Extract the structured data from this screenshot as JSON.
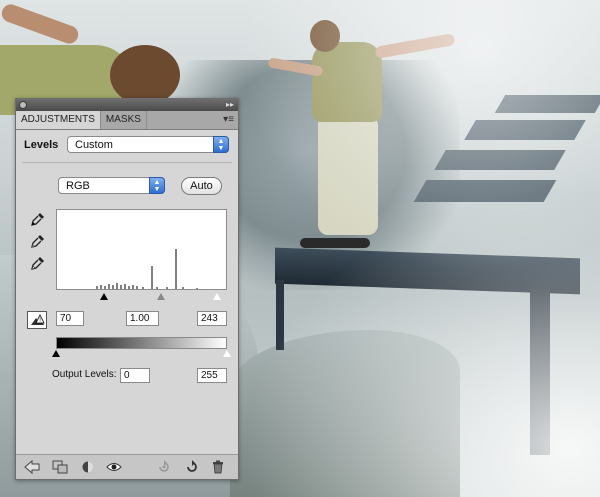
{
  "window": {
    "tabs": [
      {
        "label": "ADJUSTMENTS"
      },
      {
        "label": "MASKS"
      }
    ],
    "menu_icon": "panel-menu-icon"
  },
  "levels": {
    "label": "Levels",
    "preset": "Custom",
    "channel": "RGB",
    "auto_label": "Auto",
    "input_black": "70",
    "input_gamma": "1.00",
    "input_white": "243",
    "output_label": "Output Levels:",
    "output_black": "0",
    "output_white": "255"
  },
  "eyedroppers": [
    "black-point-eyedropper-icon",
    "gray-point-eyedropper-icon",
    "white-point-eyedropper-icon"
  ],
  "bottom_icons": [
    "back-arrow-icon",
    "clip-to-layer-icon",
    "visibility-toggle-icon",
    "eye-icon",
    "previous-state-icon",
    "reset-icon",
    "trash-icon"
  ],
  "colors": {
    "panel_bg": "#d6d6d6",
    "select_arrow": "#2e6ed6"
  }
}
